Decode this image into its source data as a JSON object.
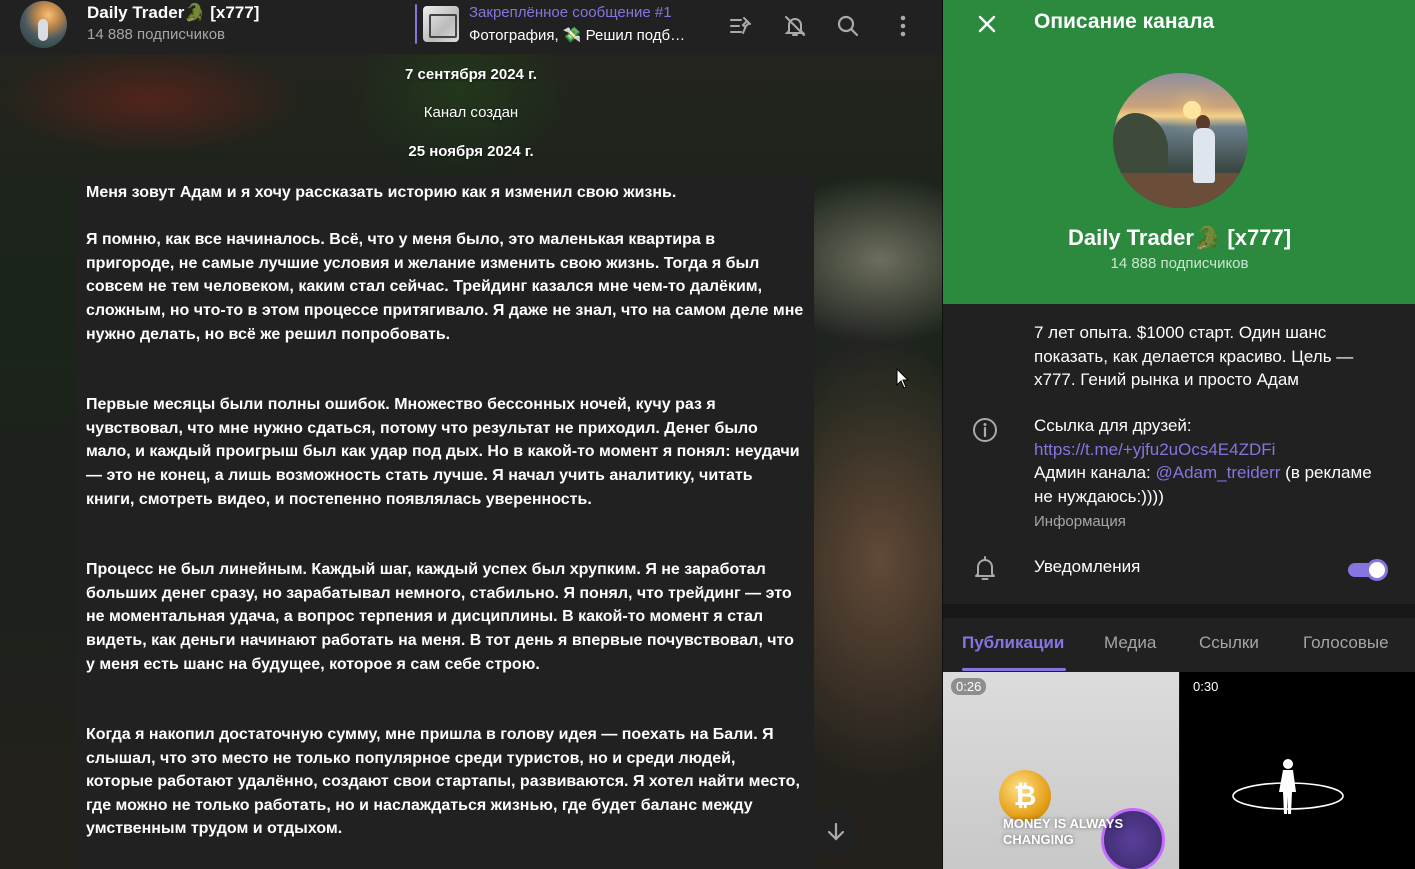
{
  "header": {
    "channel_title": "Daily Trader🐊 [x777]",
    "subscribers": "14 888 подписчиков",
    "pinned_title": "Закреплённое сообщение #1",
    "pinned_text": "Фотография, 💸 Решил подб…"
  },
  "chat": {
    "date1": "7 сентября 2024 г.",
    "service": "Канал создан",
    "date2": "25 ноября 2024 г.",
    "message": [
      "Меня зовут Адам и я хочу рассказать историю как я изменил свою жизнь.",
      "Я помню, как все начиналось. Всё, что у меня было, это маленькая квартира в пригороде, не самые лучшие условия и желание изменить свою жизнь. Тогда я был совсем не тем человеком, каким стал сейчас. Трейдинг казался мне чем-то далёким, сложным, но что-то в этом процессе притягивало. Я даже не знал, что на самом деле мне нужно делать, но всё же решил попробовать.",
      "Первые месяцы были полны ошибок. Множество бессонных ночей, кучу раз я чувствовал, что мне нужно сдаться, потому что результат не приходил. Денег было мало, и каждый проигрыш был как удар под дых. Но в какой-то момент я понял: неудачи — это не конец, а лишь возможность стать лучше. Я начал учить аналитику, читать книги, смотреть видео, и постепенно появлялась уверенность.",
      "Процесс не был линейным. Каждый шаг, каждый успех был хрупким. Я не заработал больших денег сразу, но зарабатывал немного, стабильно. Я понял, что трейдинг — это не моментальная удача, а вопрос терпения и дисциплины. В какой-то момент я стал видеть, как деньги начинают работать на меня. В тот день я впервые почувствовал, что у меня есть шанс на будущее, которое я сам себе строю.",
      "Когда я накопил достаточную сумму, мне пришла в голову идея — поехать на Бали. Я слышал, что это место не только популярное среди туристов, но и среди людей, которые работают удалённо, создают свои стартапы, развиваются. Я хотел найти место, где можно не только работать, но и наслаждаться жизнью, где будет баланс между умственным трудом и отдыхом."
    ]
  },
  "panel": {
    "title": "Описание канала",
    "name": "Daily Trader🐊 [x777]",
    "subscribers": "14 888 подписчиков",
    "description": "7 лет опыта. $1000 старт. Один шанс показать, как делается красиво. Цель — x777. Гений рынка и просто Адам",
    "friends_label": "Ссылка для друзей:",
    "invite_link": "https://t.me/+yjfu2uOcs4E4ZDFi",
    "admin_prefix": "Админ канала: ",
    "admin_handle": "@Adam_treiderr",
    "admin_suffix": " (в рекламе не нуждаюсь:))))",
    "info_label": "Информация",
    "notifications_label": "Уведомления",
    "notifications_on": true,
    "tabs": [
      "Публикации",
      "Медиа",
      "Ссылки",
      "Голосовые"
    ],
    "media": [
      {
        "duration": "0:26",
        "caption": "MONEY IS ALWAYS CHANGING"
      },
      {
        "duration": "0:30"
      }
    ]
  },
  "colors": {
    "accent": "#8774e1",
    "panel_header": "#2b8a3e",
    "surface": "#212121"
  }
}
